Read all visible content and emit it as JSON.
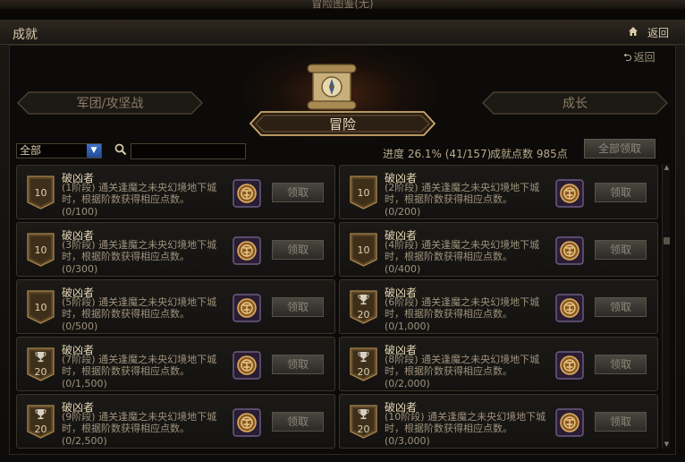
{
  "window": {
    "title": "冒险图鉴(无)"
  },
  "header": {
    "name": "成就",
    "back_label": "返回"
  },
  "sub_back": {
    "label": "返回"
  },
  "tabs": {
    "left": "军团/攻坚战",
    "mid": "冒险",
    "right": "成长"
  },
  "filter": {
    "selected": "全部",
    "search_value": ""
  },
  "progress": "进度  26.1% (41/157)",
  "points": "成就点数  985点",
  "claim_all": "全部领取",
  "achievements": [
    {
      "title": "破凶者",
      "desc": "(1阶段) 通关逢魔之未央幻境地下城时，根据阶数获得相应点数。",
      "progress": "(0/100)",
      "points": "10",
      "trophy": false,
      "claim": "领取"
    },
    {
      "title": "破凶者",
      "desc": "(2阶段) 通关逢魔之未央幻境地下城时，根据阶数获得相应点数。",
      "progress": "(0/200)",
      "points": "10",
      "trophy": false,
      "claim": "领取"
    },
    {
      "title": "破凶者",
      "desc": "(3阶段) 通关逢魔之未央幻境地下城时，根据阶数获得相应点数。",
      "progress": "(0/300)",
      "points": "10",
      "trophy": false,
      "claim": "领取"
    },
    {
      "title": "破凶者",
      "desc": "(4阶段) 通关逢魔之未央幻境地下城时，根据阶数获得相应点数。",
      "progress": "(0/400)",
      "points": "10",
      "trophy": false,
      "claim": "领取"
    },
    {
      "title": "破凶者",
      "desc": "(5阶段) 通关逢魔之未央幻境地下城时，根据阶数获得相应点数。",
      "progress": "(0/500)",
      "points": "10",
      "trophy": false,
      "claim": "领取"
    },
    {
      "title": "破凶者",
      "desc": "(6阶段) 通关逢魔之未央幻境地下城时，根据阶数获得相应点数。",
      "progress": "(0/1,000)",
      "points": "20",
      "trophy": true,
      "claim": "领取"
    },
    {
      "title": "破凶者",
      "desc": "(7阶段) 通关逢魔之未央幻境地下城时，根据阶数获得相应点数。",
      "progress": "(0/1,500)",
      "points": "20",
      "trophy": true,
      "claim": "领取"
    },
    {
      "title": "破凶者",
      "desc": "(8阶段) 通关逢魔之未央幻境地下城时，根据阶数获得相应点数。",
      "progress": "(0/2,000)",
      "points": "20",
      "trophy": true,
      "claim": "领取"
    },
    {
      "title": "破凶者",
      "desc": "(9阶段) 通关逢魔之未央幻境地下城时，根据阶数获得相应点数。",
      "progress": "(0/2,500)",
      "points": "20",
      "trophy": true,
      "claim": "领取"
    },
    {
      "title": "破凶者",
      "desc": "(10阶段) 通关逢魔之未央幻境地下城时，根据阶数获得相应点数。",
      "progress": "(0/3,000)",
      "points": "20",
      "trophy": true,
      "claim": "领取"
    }
  ]
}
